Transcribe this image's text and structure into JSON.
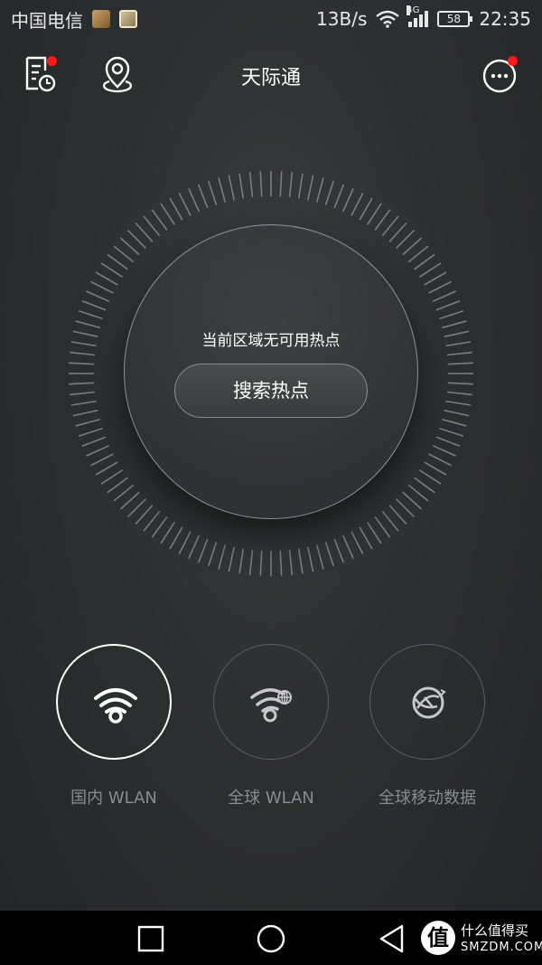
{
  "status_bar": {
    "carrier": "中国电信",
    "speed": "13B/s",
    "network_type": "4G",
    "battery": "58",
    "time": "22:35"
  },
  "header": {
    "title": "天际通",
    "icons": [
      "history-icon",
      "location-icon",
      "more-icon"
    ]
  },
  "main": {
    "status_text": "当前区域无可用热点",
    "search_button": "搜索热点"
  },
  "modes": [
    {
      "label": "国内 WLAN",
      "icon": "wifi-icon",
      "selected": true
    },
    {
      "label": "全球 WLAN",
      "icon": "global-wifi-icon",
      "selected": false
    },
    {
      "label": "全球移动数据",
      "icon": "globe-data-icon",
      "selected": false
    }
  ],
  "watermark": {
    "logo_char": "值",
    "line1": "什么值得买",
    "line2": "SMZDM.COM"
  },
  "colors": {
    "accent_red": "#ff1a1a",
    "label_gray": "#8a8b8c"
  }
}
